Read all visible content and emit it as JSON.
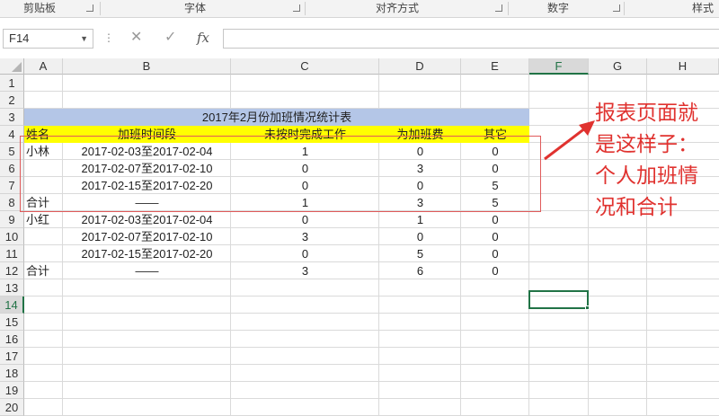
{
  "ribbon": {
    "groups": [
      {
        "label": "剪贴板"
      },
      {
        "label": "字体"
      },
      {
        "label": "对齐方式"
      },
      {
        "label": "数字"
      },
      {
        "label": "样式"
      }
    ]
  },
  "formula_bar": {
    "name_box": "F14",
    "fx": "fx",
    "formula": ""
  },
  "columns": [
    "A",
    "B",
    "C",
    "D",
    "E",
    "F",
    "G",
    "H"
  ],
  "selected_column": "F",
  "rows": [
    "1",
    "2",
    "3",
    "4",
    "5",
    "6",
    "7",
    "8",
    "9",
    "10",
    "11",
    "12",
    "13",
    "14",
    "15",
    "16",
    "17",
    "18",
    "19",
    "20"
  ],
  "selected_row": "14",
  "sheet": {
    "title": "2017年2月份加班情况统计表",
    "headers": [
      "姓名",
      "加班时间段",
      "未按时完成工作",
      "为加班费",
      "其它"
    ],
    "rows": [
      [
        "小林",
        "2017-02-03至2017-02-04",
        "1",
        "0",
        "0"
      ],
      [
        "",
        "2017-02-07至2017-02-10",
        "0",
        "3",
        "0"
      ],
      [
        "",
        "2017-02-15至2017-02-20",
        "0",
        "0",
        "5"
      ],
      [
        "合计",
        "——",
        "1",
        "3",
        "5"
      ],
      [
        "小红",
        "2017-02-03至2017-02-04",
        "0",
        "1",
        "0"
      ],
      [
        "",
        "2017-02-07至2017-02-10",
        "3",
        "0",
        "0"
      ],
      [
        "",
        "2017-02-15至2017-02-20",
        "0",
        "5",
        "0"
      ],
      [
        "合计",
        "——",
        "3",
        "6",
        "0"
      ]
    ]
  },
  "annotation": {
    "text": "报表页面就\n是这样子：\n个人加班情\n况和合计",
    "color": "#e0322f"
  },
  "colors": {
    "title_band": "#b4c6e7",
    "header_band": "#ffff00",
    "selection": "#217346"
  }
}
